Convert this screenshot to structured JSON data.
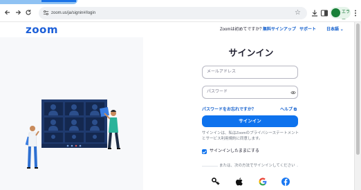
{
  "browser": {
    "url": "zoom.us/ja/signin#/login",
    "profile_label": "エラー"
  },
  "header": {
    "logo": "zoom",
    "first_time_text": "Zoomは初めてですか？",
    "free_signup": "無料サインアップ",
    "support": "サポート",
    "language": "日本語"
  },
  "form": {
    "title": "サインイン",
    "email_placeholder": "メールアドレス",
    "password_placeholder": "パスワード",
    "forgot_password": "パスワードをお忘れですか？",
    "help": "ヘルプ",
    "signin_button": "サインイン",
    "terms_prefix": "サインインは、私はZoomの",
    "terms_privacy": "プライバシーステートメント",
    "terms_and": "と",
    "terms_service": "サービス利用規約",
    "terms_suffix": "に同意します。",
    "keep_signed_in": "サインインしたままにする",
    "keep_signed_in_checked": true,
    "divider_text": "または、次の方法でサインインしてください",
    "sso_options": [
      "key-icon",
      "apple-icon",
      "google-icon",
      "facebook-icon"
    ]
  },
  "colors": {
    "brand": "#0e72ed",
    "logo": "#1c5fd8",
    "link": "#0e5ccc",
    "illustration_navy": "#1f3a6e"
  }
}
